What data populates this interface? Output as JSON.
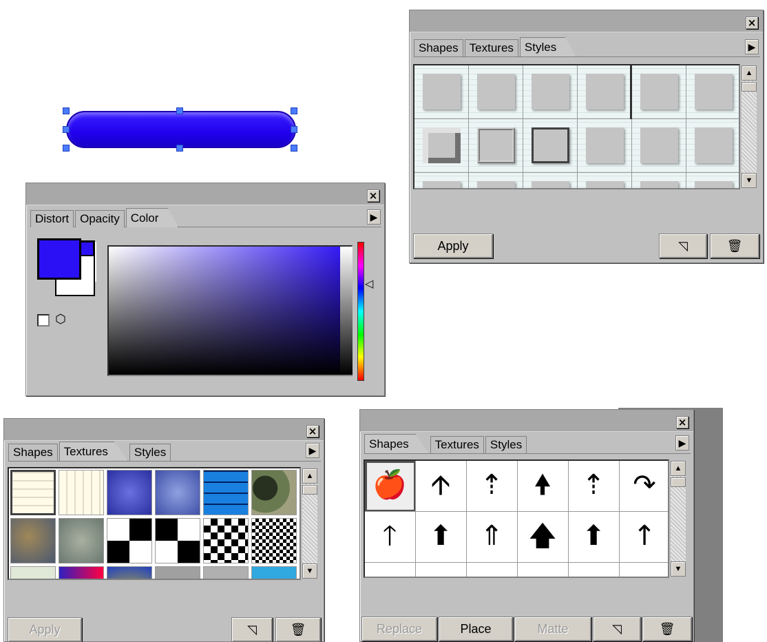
{
  "colors": {
    "accent": "#2b10f5",
    "panel": "#c0c0c0",
    "handle": "#4a7cff"
  },
  "canvas": {
    "shape_name": "rounded-rectangle"
  },
  "color_panel": {
    "tabs": [
      {
        "label": "Distort"
      },
      {
        "label": "Opacity"
      },
      {
        "label": "Color"
      }
    ],
    "active_tab": "Color",
    "close": "×",
    "menu": "▶",
    "hue_pointer": "◁"
  },
  "styles_panel": {
    "tabs": [
      {
        "label": "Shapes"
      },
      {
        "label": "Textures"
      },
      {
        "label": "Styles"
      }
    ],
    "active_tab": "Styles",
    "close": "×",
    "menu": "▶",
    "apply_label": "Apply",
    "new_icon": "new-item-icon",
    "trash_icon": "trash-icon",
    "new_glyph": "◹",
    "trash_glyph": "🗑",
    "scroll_up": "▲",
    "scroll_down": "▼"
  },
  "textures_panel": {
    "tabs": [
      {
        "label": "Shapes"
      },
      {
        "label": "Textures"
      },
      {
        "label": "Styles"
      }
    ],
    "active_tab": "Textures",
    "close": "×",
    "menu": "▶",
    "apply_label": "Apply",
    "new_glyph": "◹",
    "trash_glyph": "🗑",
    "scroll_up": "▲",
    "scroll_down": "▼"
  },
  "shapes_panel": {
    "tabs": [
      {
        "label": "Shapes"
      },
      {
        "label": "Textures"
      },
      {
        "label": "Styles"
      }
    ],
    "active_tab": "Shapes",
    "close": "×",
    "menu": "▶",
    "replace_label": "Replace",
    "place_label": "Place",
    "matte_label": "Matte",
    "new_glyph": "◹",
    "trash_glyph": "🗑",
    "scroll_up": "▲",
    "scroll_down": "▼",
    "row1": [
      "🍎",
      "🡩",
      "⇡",
      "🠝",
      "⇡",
      "↷"
    ],
    "row2": [
      "🡑",
      "⬆",
      "⇑",
      "🡅",
      "⬆",
      "↑"
    ]
  }
}
